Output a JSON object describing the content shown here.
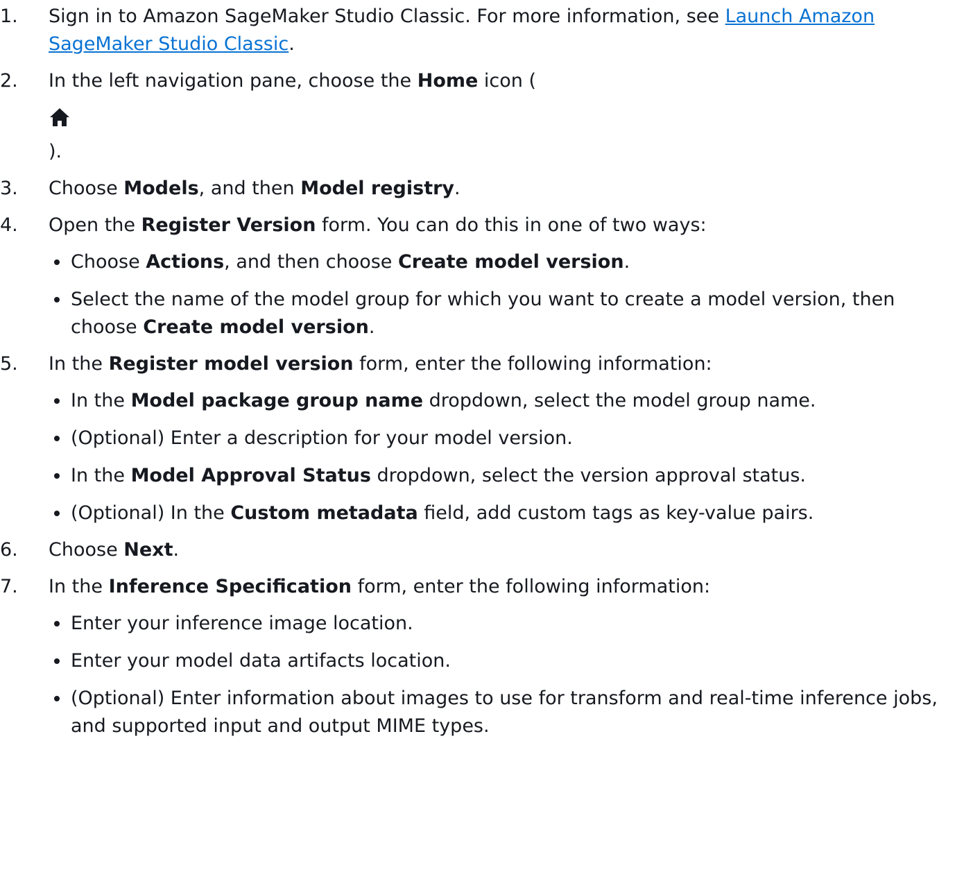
{
  "steps": [
    {
      "num": "1.",
      "a": "Sign in to Amazon SageMaker Studio Classic. For more information, see ",
      "link": "Launch Amazon SageMaker Studio Classic",
      "b": "."
    },
    {
      "num": "2.",
      "a": "In the left navigation pane, choose the ",
      "bold": "Home",
      "b": " icon (",
      "icon": "home-icon",
      "c": ")."
    },
    {
      "num": "3.",
      "a": "Choose ",
      "bold1": "Models",
      "b": ", and then ",
      "bold2": "Model registry",
      "c": "."
    },
    {
      "num": "4.",
      "a": "Open the ",
      "bold": "Register Version",
      "b": " form. You can do this in one of two ways:",
      "bullets": [
        {
          "a": "Choose ",
          "bold1": "Actions",
          "b": ", and then choose ",
          "bold2": "Create model version",
          "c": "."
        },
        {
          "a": "Select the name of the model group for which you want to create a model version, then choose ",
          "bold": "Create model version",
          "b": "."
        }
      ]
    },
    {
      "num": "5.",
      "a": "In the ",
      "bold": "Register model version",
      "b": " form, enter the following information:",
      "bullets": [
        {
          "a": "In the ",
          "bold": "Model package group name",
          "b": " dropdown, select the model group name."
        },
        {
          "text": "(Optional) Enter a description for your model version."
        },
        {
          "a": "In the ",
          "bold": "Model Approval Status",
          "b": " dropdown, select the version approval status."
        },
        {
          "a": "(Optional) In the ",
          "bold": "Custom metadata",
          "b": " field, add custom tags as key-value pairs."
        }
      ]
    },
    {
      "num": "6.",
      "a": "Choose ",
      "bold": "Next",
      "b": "."
    },
    {
      "num": "7.",
      "a": "In the ",
      "bold": "Inference Specification",
      "b": " form, enter the following information:",
      "bullets": [
        {
          "text": "Enter your inference image location."
        },
        {
          "text": "Enter your model data artifacts location."
        },
        {
          "text": "(Optional) Enter information about images to use for transform and real-time inference jobs, and supported input and output MIME types."
        }
      ]
    }
  ]
}
